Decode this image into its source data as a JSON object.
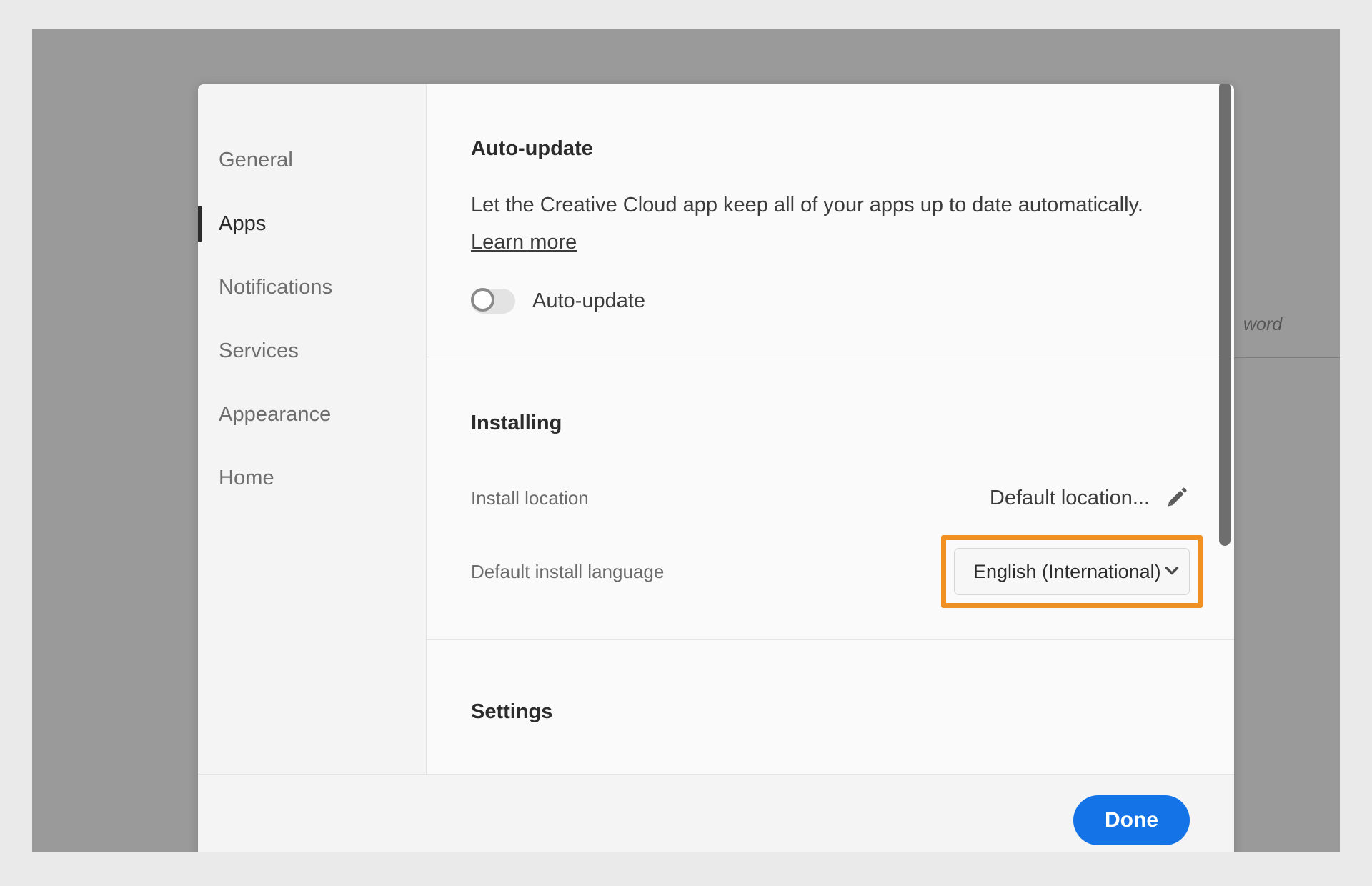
{
  "background": {
    "occluded_field_text": "word"
  },
  "dialog": {
    "sidebar": {
      "items": [
        {
          "label": "General",
          "selected": false
        },
        {
          "label": "Apps",
          "selected": true
        },
        {
          "label": "Notifications",
          "selected": false
        },
        {
          "label": "Services",
          "selected": false
        },
        {
          "label": "Appearance",
          "selected": false
        },
        {
          "label": "Home",
          "selected": false
        }
      ]
    },
    "sections": {
      "auto_update": {
        "title": "Auto-update",
        "description": "Let the Creative Cloud app keep all of your apps up to date automatically.",
        "learn_more": "Learn more",
        "toggle_label": "Auto-update",
        "toggle_state": "off"
      },
      "installing": {
        "title": "Installing",
        "install_location_label": "Install location",
        "install_location_value": "Default location...",
        "edit_icon": "pencil-icon",
        "default_language_label": "Default install language",
        "default_language_value": "English (International)",
        "dropdown_icon": "chevron-down-icon",
        "highlight_color": "#ef9122"
      },
      "settings": {
        "title": "Settings"
      }
    },
    "footer": {
      "done_label": "Done",
      "done_color": "#1473e6"
    }
  }
}
